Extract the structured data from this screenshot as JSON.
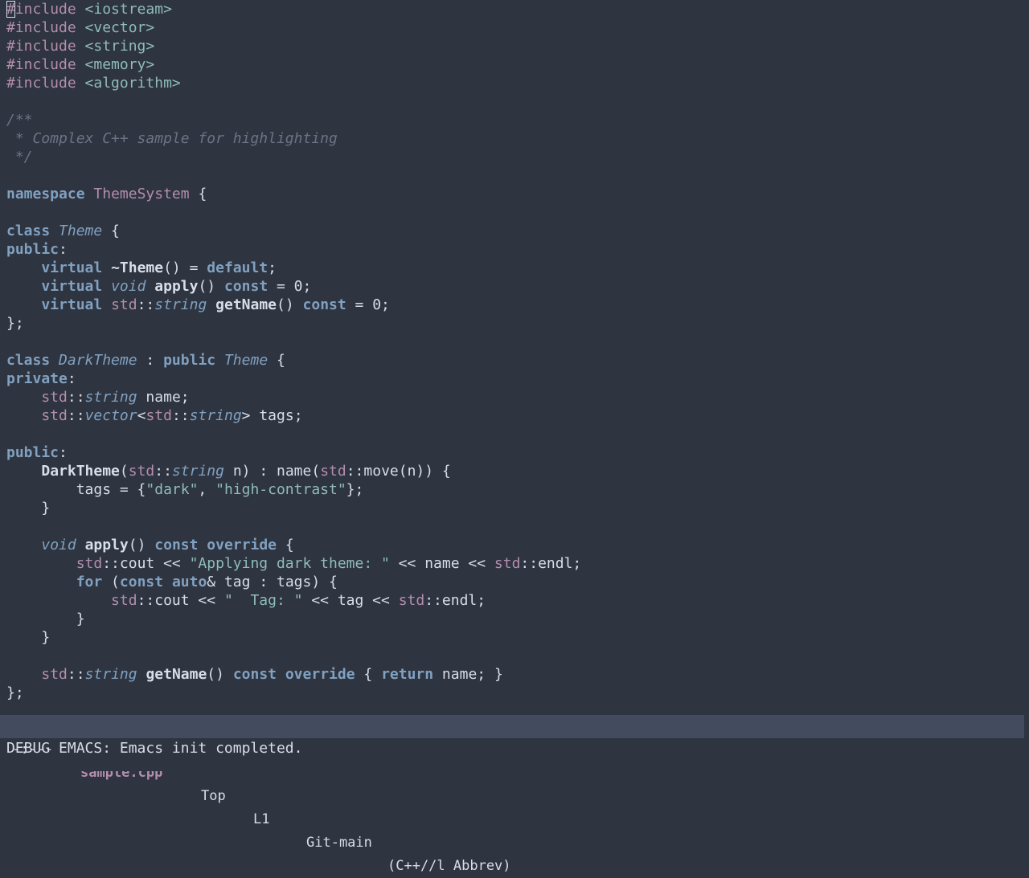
{
  "editor": {
    "lines": [
      [
        {
          "t": "#",
          "c": "preproc",
          "cursor": true
        },
        {
          "t": "include",
          "c": "preproc"
        },
        {
          "t": " <iostream>",
          "c": "strlit"
        }
      ],
      [
        {
          "t": "#include",
          "c": "preproc"
        },
        {
          "t": " <vector>",
          "c": "strlit"
        }
      ],
      [
        {
          "t": "#include",
          "c": "preproc"
        },
        {
          "t": " <string>",
          "c": "strlit"
        }
      ],
      [
        {
          "t": "#include",
          "c": "preproc"
        },
        {
          "t": " <memory>",
          "c": "strlit"
        }
      ],
      [
        {
          "t": "#include",
          "c": "preproc"
        },
        {
          "t": " <algorithm>",
          "c": "strlit"
        }
      ],
      [],
      [
        {
          "t": "/**",
          "c": "comment"
        }
      ],
      [
        {
          "t": " * Complex C++ sample for highlighting",
          "c": "comment"
        }
      ],
      [
        {
          "t": " */",
          "c": "comment"
        }
      ],
      [],
      [
        {
          "t": "namespace",
          "c": "kw"
        },
        {
          "t": " ",
          "c": "plain"
        },
        {
          "t": "ThemeSystem",
          "c": "ns"
        },
        {
          "t": " {",
          "c": "plain"
        }
      ],
      [],
      [
        {
          "t": "class",
          "c": "kw"
        },
        {
          "t": " ",
          "c": "plain"
        },
        {
          "t": "Theme",
          "c": "type"
        },
        {
          "t": " {",
          "c": "plain"
        }
      ],
      [
        {
          "t": "public",
          "c": "kw"
        },
        {
          "t": ":",
          "c": "plain"
        }
      ],
      [
        {
          "t": "    ",
          "c": "plain"
        },
        {
          "t": "virtual",
          "c": "kw"
        },
        {
          "t": " ",
          "c": "plain"
        },
        {
          "t": "~Theme",
          "c": "fn"
        },
        {
          "t": "() = ",
          "c": "plain"
        },
        {
          "t": "default",
          "c": "kw"
        },
        {
          "t": ";",
          "c": "plain"
        }
      ],
      [
        {
          "t": "    ",
          "c": "plain"
        },
        {
          "t": "virtual",
          "c": "kw"
        },
        {
          "t": " ",
          "c": "plain"
        },
        {
          "t": "void",
          "c": "type"
        },
        {
          "t": " ",
          "c": "plain"
        },
        {
          "t": "apply",
          "c": "fn"
        },
        {
          "t": "() ",
          "c": "plain"
        },
        {
          "t": "const",
          "c": "kw"
        },
        {
          "t": " = 0;",
          "c": "plain"
        }
      ],
      [
        {
          "t": "    ",
          "c": "plain"
        },
        {
          "t": "virtual",
          "c": "kw"
        },
        {
          "t": " ",
          "c": "plain"
        },
        {
          "t": "std",
          "c": "ns"
        },
        {
          "t": "::",
          "c": "plain"
        },
        {
          "t": "string",
          "c": "type"
        },
        {
          "t": " ",
          "c": "plain"
        },
        {
          "t": "getName",
          "c": "fn"
        },
        {
          "t": "() ",
          "c": "plain"
        },
        {
          "t": "const",
          "c": "kw"
        },
        {
          "t": " = 0;",
          "c": "plain"
        }
      ],
      [
        {
          "t": "};",
          "c": "plain"
        }
      ],
      [],
      [
        {
          "t": "class",
          "c": "kw"
        },
        {
          "t": " ",
          "c": "plain"
        },
        {
          "t": "DarkTheme",
          "c": "type"
        },
        {
          "t": " : ",
          "c": "plain"
        },
        {
          "t": "public",
          "c": "kw"
        },
        {
          "t": " ",
          "c": "plain"
        },
        {
          "t": "Theme",
          "c": "type"
        },
        {
          "t": " {",
          "c": "plain"
        }
      ],
      [
        {
          "t": "private",
          "c": "kw"
        },
        {
          "t": ":",
          "c": "plain"
        }
      ],
      [
        {
          "t": "    ",
          "c": "plain"
        },
        {
          "t": "std",
          "c": "ns"
        },
        {
          "t": "::",
          "c": "plain"
        },
        {
          "t": "string",
          "c": "type"
        },
        {
          "t": " name;",
          "c": "plain"
        }
      ],
      [
        {
          "t": "    ",
          "c": "plain"
        },
        {
          "t": "std",
          "c": "ns"
        },
        {
          "t": "::",
          "c": "plain"
        },
        {
          "t": "vector",
          "c": "type"
        },
        {
          "t": "<",
          "c": "plain"
        },
        {
          "t": "std",
          "c": "ns"
        },
        {
          "t": "::",
          "c": "plain"
        },
        {
          "t": "string",
          "c": "type"
        },
        {
          "t": "> tags;",
          "c": "plain"
        }
      ],
      [],
      [
        {
          "t": "public",
          "c": "kw"
        },
        {
          "t": ":",
          "c": "plain"
        }
      ],
      [
        {
          "t": "    ",
          "c": "plain"
        },
        {
          "t": "DarkTheme",
          "c": "fn"
        },
        {
          "t": "(",
          "c": "plain"
        },
        {
          "t": "std",
          "c": "ns"
        },
        {
          "t": "::",
          "c": "plain"
        },
        {
          "t": "string",
          "c": "type"
        },
        {
          "t": " n) : name(",
          "c": "plain"
        },
        {
          "t": "std",
          "c": "ns"
        },
        {
          "t": "::move(n)) {",
          "c": "plain"
        }
      ],
      [
        {
          "t": "        tags = {",
          "c": "plain"
        },
        {
          "t": "\"dark\"",
          "c": "strlit"
        },
        {
          "t": ", ",
          "c": "plain"
        },
        {
          "t": "\"high-contrast\"",
          "c": "strlit"
        },
        {
          "t": "};",
          "c": "plain"
        }
      ],
      [
        {
          "t": "    }",
          "c": "plain"
        }
      ],
      [],
      [
        {
          "t": "    ",
          "c": "plain"
        },
        {
          "t": "void",
          "c": "type"
        },
        {
          "t": " ",
          "c": "plain"
        },
        {
          "t": "apply",
          "c": "fn"
        },
        {
          "t": "() ",
          "c": "plain"
        },
        {
          "t": "const",
          "c": "kw"
        },
        {
          "t": " ",
          "c": "plain"
        },
        {
          "t": "override",
          "c": "kw"
        },
        {
          "t": " {",
          "c": "plain"
        }
      ],
      [
        {
          "t": "        ",
          "c": "plain"
        },
        {
          "t": "std",
          "c": "ns"
        },
        {
          "t": "::cout << ",
          "c": "plain"
        },
        {
          "t": "\"Applying dark theme: \"",
          "c": "strlit"
        },
        {
          "t": " << name << ",
          "c": "plain"
        },
        {
          "t": "std",
          "c": "ns"
        },
        {
          "t": "::endl;",
          "c": "plain"
        }
      ],
      [
        {
          "t": "        ",
          "c": "plain"
        },
        {
          "t": "for",
          "c": "kw"
        },
        {
          "t": " (",
          "c": "plain"
        },
        {
          "t": "const",
          "c": "kw"
        },
        {
          "t": " ",
          "c": "plain"
        },
        {
          "t": "auto",
          "c": "kw"
        },
        {
          "t": "& tag : tags) {",
          "c": "plain"
        }
      ],
      [
        {
          "t": "            ",
          "c": "plain"
        },
        {
          "t": "std",
          "c": "ns"
        },
        {
          "t": "::cout << ",
          "c": "plain"
        },
        {
          "t": "\"  Tag: \"",
          "c": "strlit"
        },
        {
          "t": " << tag << ",
          "c": "plain"
        },
        {
          "t": "std",
          "c": "ns"
        },
        {
          "t": "::endl;",
          "c": "plain"
        }
      ],
      [
        {
          "t": "        }",
          "c": "plain"
        }
      ],
      [
        {
          "t": "    }",
          "c": "plain"
        }
      ],
      [],
      [
        {
          "t": "    ",
          "c": "plain"
        },
        {
          "t": "std",
          "c": "ns"
        },
        {
          "t": "::",
          "c": "plain"
        },
        {
          "t": "string",
          "c": "type"
        },
        {
          "t": " ",
          "c": "plain"
        },
        {
          "t": "getName",
          "c": "fn"
        },
        {
          "t": "() ",
          "c": "plain"
        },
        {
          "t": "const",
          "c": "kw"
        },
        {
          "t": " ",
          "c": "plain"
        },
        {
          "t": "override",
          "c": "kw"
        },
        {
          "t": " { ",
          "c": "plain"
        },
        {
          "t": "return",
          "c": "kw"
        },
        {
          "t": " name; }",
          "c": "plain"
        }
      ],
      [
        {
          "t": "};",
          "c": "plain"
        }
      ]
    ]
  },
  "modeline": {
    "status": "-:---",
    "buffer_name": "sample.cpp",
    "position": "Top",
    "line": "L1",
    "vc": "Git-main",
    "modes": "(C++//l Abbrev)"
  },
  "echo_area": {
    "message": "DEBUG EMACS: Emacs init completed."
  },
  "colors": {
    "background": "#2e3440",
    "foreground": "#d8dee9",
    "keyword": "#81a1c1",
    "preprocessor": "#b48ead",
    "string": "#8fbcbb",
    "comment": "#6b7385",
    "modeline_bg": "#434c5e"
  }
}
